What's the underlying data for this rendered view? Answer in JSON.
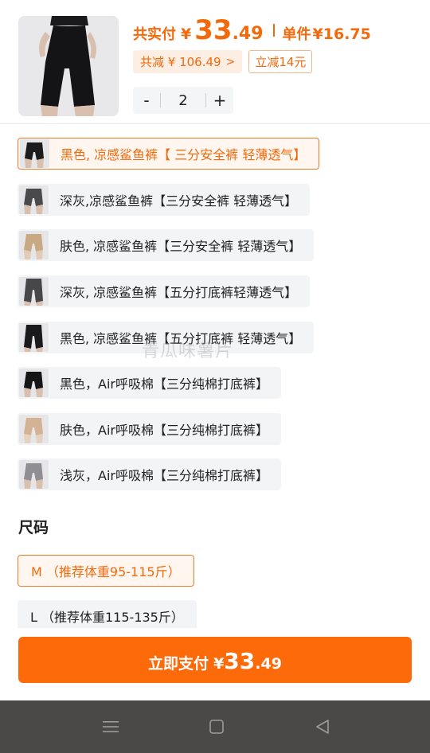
{
  "product": {
    "total_label": "共实付",
    "currency": "¥",
    "total_int": "33",
    "total_dec": ".49",
    "unit_label": "单件",
    "unit_price": "¥16.75",
    "discount_total": "共减 ¥ 106.49",
    "discount_chevron": ">",
    "instant_discount": "立减14元"
  },
  "quantity": {
    "minus": "-",
    "value": "2",
    "plus": "+"
  },
  "options": [
    {
      "label": "黑色, 凉感鲨鱼裤【 三分安全裤 轻薄透气】",
      "selected": true,
      "swatch": "#1c1c1e"
    },
    {
      "label": "深灰,凉感鲨鱼裤【三分安全裤 轻薄透气】",
      "selected": false,
      "swatch": "#4a4a4c"
    },
    {
      "label": "肤色, 凉感鲨鱼裤【三分安全裤 轻薄透气】",
      "selected": false,
      "swatch": "#c9a884"
    },
    {
      "label": "深灰, 凉感鲨鱼裤【五分打底裤轻薄透气】",
      "selected": false,
      "swatch": "#47474a"
    },
    {
      "label": "黑色, 凉感鲨鱼裤【五分打底裤 轻薄透气】",
      "selected": false,
      "swatch": "#1a1a1c"
    },
    {
      "label": "黑色，Air呼吸棉【三分纯棉打底裤】",
      "selected": false,
      "swatch": "#151516"
    },
    {
      "label": "肤色，Air呼吸棉【三分纯棉打底裤】",
      "selected": false,
      "swatch": "#d4b394"
    },
    {
      "label": "浅灰，Air呼吸棉【三分纯棉打底裤】",
      "selected": false,
      "swatch": "#8f8f93"
    }
  ],
  "size_section": {
    "title": "尺码",
    "sizes": [
      {
        "label": "M （推荐体重95-115斤）",
        "selected": true
      },
      {
        "label": "L （推荐体重115-135斤）",
        "selected": false
      }
    ]
  },
  "watermark": "青瓜味薯片",
  "pay_button": {
    "label": "立即支付",
    "currency": "¥",
    "amount_int": "33",
    "amount_dec": ".49"
  },
  "nav": {
    "menu_icon": "menu-icon",
    "home_icon": "home-square-icon",
    "back_icon": "back-triangle-icon",
    "bar_color": "#4b4848"
  },
  "colors": {
    "accent": "#f36a0c",
    "button": "#fd6a0a"
  }
}
